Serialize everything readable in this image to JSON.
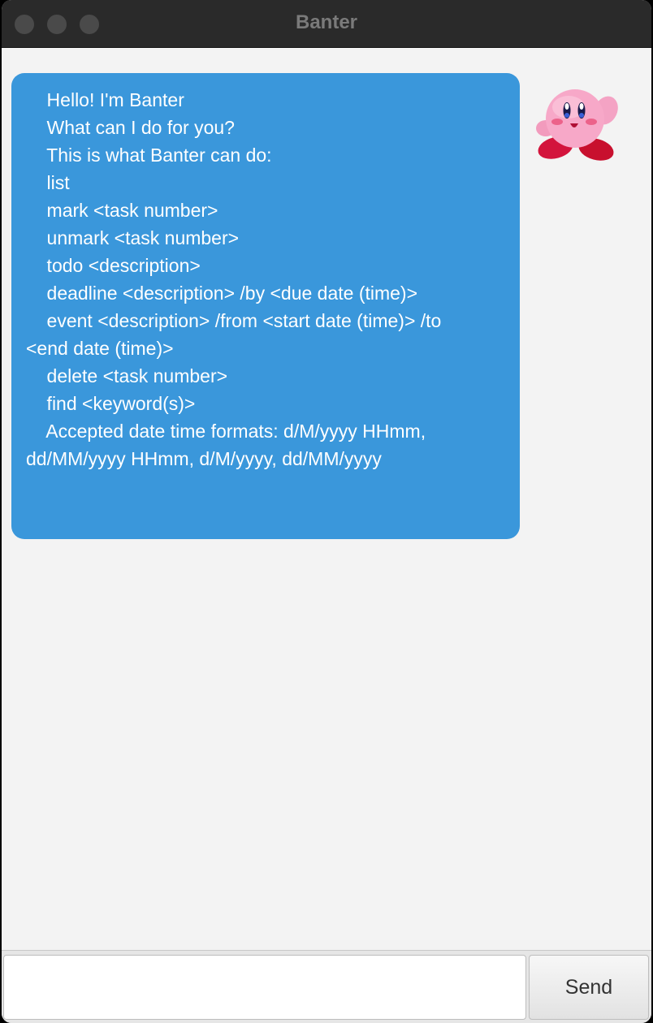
{
  "window": {
    "title": "Banter"
  },
  "chat": {
    "messages": [
      {
        "sender": "bot",
        "avatar": "kirby-avatar",
        "lines": [
          "    Hello! I'm Banter",
          "    What can I do for you?",
          "",
          "    This is what Banter can do:",
          "    list",
          "    mark <task number>",
          "    unmark <task number>",
          "    todo <description>",
          "    deadline <description> /by <due date (time)>",
          "    event <description> /from <start date (time)> /to",
          "<end date (time)>",
          "    delete <task number>",
          "    find <keyword(s)>",
          "",
          "    Accepted date time formats: d/M/yyyy HHmm,",
          "dd/MM/yyyy HHmm, d/M/yyyy, dd/MM/yyyy"
        ]
      }
    ]
  },
  "input": {
    "value": "",
    "placeholder": ""
  },
  "send_button": {
    "label": "Send"
  },
  "colors": {
    "bubble": "#3a97db",
    "background": "#f3f3f3",
    "titlebar": "#2a2a2a"
  }
}
